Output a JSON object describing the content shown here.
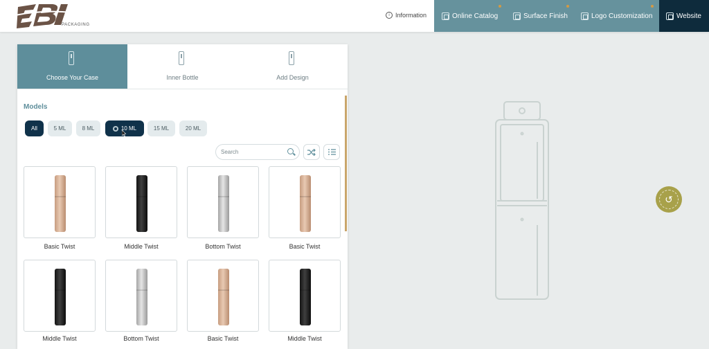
{
  "header": {
    "logo_text": "EBI",
    "logo_subtext": "PACKAGING",
    "nav": {
      "information": "Information",
      "online_catalog": "Online Catalog",
      "surface_finish": "Surface Finish",
      "logo_customization": "Logo Customization",
      "website": "Website"
    }
  },
  "tabs": [
    {
      "label": "Choose Your Case",
      "active": true
    },
    {
      "label": "Inner Bottle",
      "active": false
    },
    {
      "label": "Add Design",
      "active": false
    }
  ],
  "models": {
    "title": "Models",
    "filters": [
      "All",
      "5 ML",
      "8 ML",
      "10 ML",
      "15 ML",
      "20 ML"
    ],
    "selected_filters": [
      "All",
      "10 ML"
    ]
  },
  "search": {
    "placeholder": "Search"
  },
  "icons": {
    "information": "info-icon",
    "catalog": "catalog-icon",
    "shuffle": "shuffle-icon",
    "list": "list-icon",
    "reset": "reset-rotate-icon"
  },
  "products": [
    {
      "label": "Basic Twist",
      "color": "rose-gold"
    },
    {
      "label": "Middle Twist",
      "color": "black"
    },
    {
      "label": "Bottom Twist",
      "color": "silver"
    },
    {
      "label": "Basic Twist",
      "color": "rose-gold"
    },
    {
      "label": "Middle Twist",
      "color": "black"
    },
    {
      "label": "Bottom Twist",
      "color": "silver"
    },
    {
      "label": "Basic Twist",
      "color": "rose-gold"
    },
    {
      "label": "Middle Twist",
      "color": "black"
    }
  ],
  "colors": {
    "accent": "#5e8e9b",
    "nav_dark": "#0e2b3c",
    "chip_selected": "#10324a",
    "reset_button": "#a8a14a",
    "scroll_accent": "#c9a56a"
  }
}
